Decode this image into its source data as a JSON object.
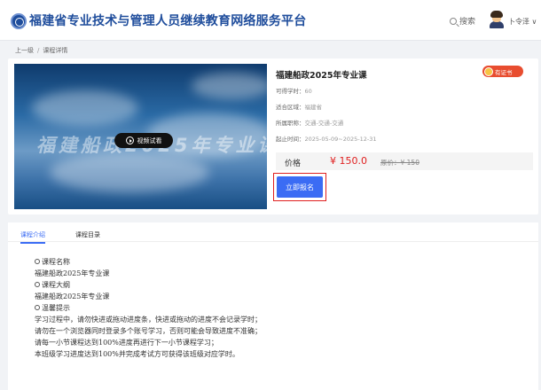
{
  "header": {
    "site_title": "福建省专业技术与管理人员继续教育网络服务平台",
    "search_label": "搜索",
    "user_name": "卜令泽 ∨"
  },
  "breadcrumb": {
    "back": "上一级",
    "separator": "/",
    "current": "课程详情"
  },
  "course": {
    "video_overlay_text": "福建船政2025年专业课",
    "play_label": "视频试看",
    "title": "福建船政2025年专业课",
    "cert_badge": "有证书",
    "credits_label": "可得学时：",
    "credits_value": "60",
    "region_label": "适合区域：",
    "region_value": "福建省",
    "job_label": "所属职称：",
    "job_value": "交通-交通-交通",
    "period_label": "起止时间：",
    "period_value": "2025-05-09~2025-12-31",
    "price_label": "价格",
    "price": "¥ 150.0",
    "original_price": "原价：¥ 150",
    "enroll_label": "立即报名"
  },
  "tabs": [
    {
      "label": "课程介绍",
      "active": true
    },
    {
      "label": "课程目录",
      "active": false
    }
  ],
  "intro": {
    "name_heading": "课程名称",
    "name_value": "福建船政2025年专业课",
    "outline_heading": "课程大纲",
    "outline_value": "福建船政2025年专业课",
    "tips_heading": "温馨提示",
    "tips": [
      "学习过程中，请勿快进或拖动进度条，快进或拖动的进度不会记录学时；",
      "请勿在一个浏览器同时登录多个账号学习，否则可能会导致进度不准确；",
      "请每一小节课程达到100%进度再进行下一小节课程学习；",
      "本班级学习进度达到100%并完成考试方可获得该班级对应学时。"
    ]
  },
  "colors": {
    "brand": "#1f4d9c",
    "accent": "#3b6cf4",
    "price": "#e02020",
    "badge": "#e84d2f"
  }
}
